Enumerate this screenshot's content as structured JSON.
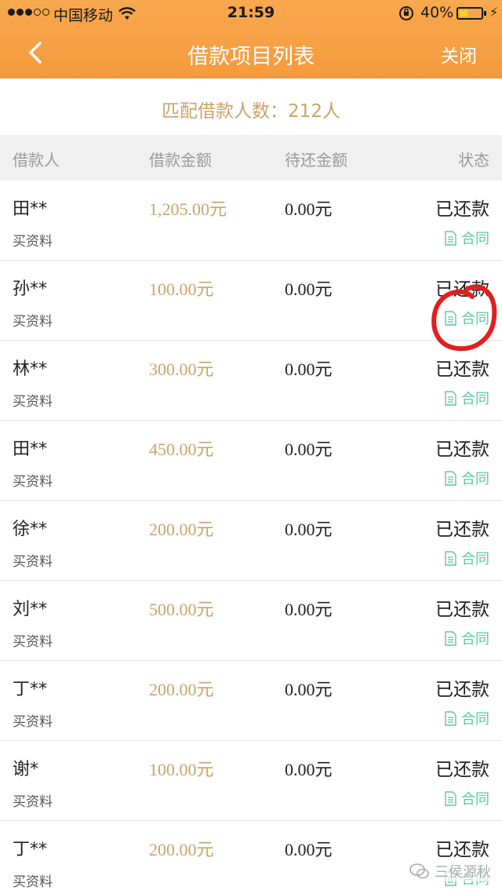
{
  "status_bar": {
    "carrier": "中国移动",
    "time": "21:59",
    "battery_percent": "40%",
    "battery_level": 0.4,
    "signal_filled": 3,
    "signal_total": 5
  },
  "nav": {
    "title": "借款项目列表",
    "close_label": "关闭",
    "back_icon": "chevron-left-icon"
  },
  "summary": {
    "text": "匹配借款人数：212人"
  },
  "table": {
    "columns": {
      "borrower": "借款人",
      "amount": "借款金额",
      "remaining": "待还金额",
      "status": "状态"
    },
    "rows": [
      {
        "name": "田**",
        "purpose": "买资料",
        "amount": "1,205.00元",
        "remaining": "0.00元",
        "status": "已还款",
        "contract": "合同"
      },
      {
        "name": "孙**",
        "purpose": "买资料",
        "amount": "100.00元",
        "remaining": "0.00元",
        "status": "已还款",
        "contract": "合同"
      },
      {
        "name": "林**",
        "purpose": "买资料",
        "amount": "300.00元",
        "remaining": "0.00元",
        "status": "已还款",
        "contract": "合同"
      },
      {
        "name": "田**",
        "purpose": "买资料",
        "amount": "450.00元",
        "remaining": "0.00元",
        "status": "已还款",
        "contract": "合同"
      },
      {
        "name": "徐**",
        "purpose": "买资料",
        "amount": "200.00元",
        "remaining": "0.00元",
        "status": "已还款",
        "contract": "合同"
      },
      {
        "name": "刘**",
        "purpose": "买资料",
        "amount": "500.00元",
        "remaining": "0.00元",
        "status": "已还款",
        "contract": "合同"
      },
      {
        "name": "丁**",
        "purpose": "买资料",
        "amount": "200.00元",
        "remaining": "0.00元",
        "status": "已还款",
        "contract": "合同"
      },
      {
        "name": "谢*",
        "purpose": "买资料",
        "amount": "100.00元",
        "remaining": "0.00元",
        "status": "已还款",
        "contract": "合同"
      },
      {
        "name": "丁**",
        "purpose": "买资料",
        "amount": "200.00元",
        "remaining": "0.00元",
        "status": "已还款",
        "contract": "合同"
      }
    ]
  },
  "watermark": {
    "text": "三侯源秋"
  },
  "colors": {
    "header": "#f59a3c",
    "amount": "#c9a36a",
    "contract": "#5cc6a7",
    "annotation": "#e02020"
  }
}
